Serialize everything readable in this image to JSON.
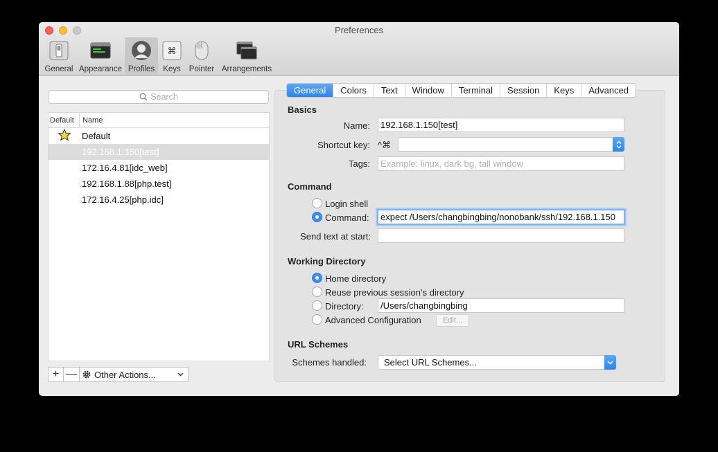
{
  "window": {
    "title": "Preferences"
  },
  "toolbar": {
    "items": [
      {
        "label": "General",
        "icon": "switch-icon"
      },
      {
        "label": "Appearance",
        "icon": "appearance-icon"
      },
      {
        "label": "Profiles",
        "icon": "profile-user-icon"
      },
      {
        "label": "Keys",
        "icon": "command-key-icon"
      },
      {
        "label": "Pointer",
        "icon": "mouse-icon"
      },
      {
        "label": "Arrangements",
        "icon": "windows-icon"
      }
    ],
    "selected": "Profiles"
  },
  "profiles_panel": {
    "search_placeholder": "Search",
    "columns": [
      "Default",
      "Name"
    ],
    "profiles": [
      {
        "name": "Default",
        "is_default": true
      },
      {
        "name": "192.168.1.150[test]",
        "is_default": false
      },
      {
        "name": "172.16.4.81[idc_web]",
        "is_default": false
      },
      {
        "name": "192.168.1.88[php.test]",
        "is_default": false
      },
      {
        "name": "172.16.4.25[php.idc]",
        "is_default": false
      }
    ],
    "selected_profile": "192.168.1.150[test]",
    "add_label": "+",
    "remove_label": "—",
    "other_actions_label": "Other Actions..."
  },
  "tabs": [
    "General",
    "Colors",
    "Text",
    "Window",
    "Terminal",
    "Session",
    "Keys",
    "Advanced"
  ],
  "active_tab": "General",
  "basics": {
    "title": "Basics",
    "name_label": "Name:",
    "name_value": "192.168.1.150[test]",
    "shortcut_label": "Shortcut key:",
    "shortcut_modifiers": "^⌘",
    "shortcut_value": "",
    "tags_label": "Tags:",
    "tags_placeholder": "Example: linux, dark bg, tall window"
  },
  "command": {
    "title": "Command",
    "login_shell_label": "Login shell",
    "command_label": "Command:",
    "command_value": "expect /Users/changbingbing/nonobank/ssh/192.168.1.150",
    "selected": "Command",
    "send_text_label": "Send text at start:",
    "send_text_value": ""
  },
  "working_directory": {
    "title": "Working Directory",
    "home_label": "Home directory",
    "reuse_label": "Reuse previous session's directory",
    "directory_label": "Directory:",
    "directory_value": "/Users/changbingbing",
    "advanced_label": "Advanced Configuration",
    "edit_label": "Edit...",
    "selected": "Home directory"
  },
  "url_schemes": {
    "title": "URL Schemes",
    "handled_label": "Schemes handled:",
    "select_value": "Select URL Schemes..."
  },
  "colors": {
    "accent": "#2e84ee",
    "selection_row": "#dcdcdc"
  }
}
